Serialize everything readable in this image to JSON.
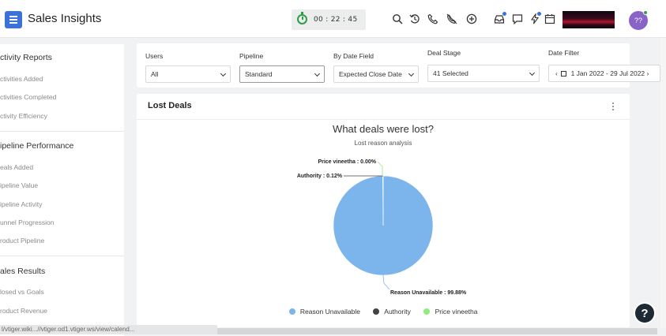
{
  "app": {
    "title": "Sales Insights"
  },
  "header": {
    "timer": "00 : 22 : 45",
    "avatar_text": "??"
  },
  "sidebar": {
    "sections": [
      {
        "title": "ctivity Reports",
        "items": [
          "ctivities Added",
          "ctivities Completed",
          "ctivity Efficiency"
        ]
      },
      {
        "title": "ipeline Performance",
        "items": [
          "eals Added",
          "ipeline Value",
          "ipeline Activity",
          "unnel Progression",
          "roduct Pipeline"
        ]
      },
      {
        "title": "ales Results",
        "items": [
          "losed vs Goals",
          "roduct Revenue"
        ]
      }
    ]
  },
  "filters": {
    "users": {
      "label": "Users",
      "value": "All"
    },
    "pipeline": {
      "label": "Pipeline",
      "value": "Standard"
    },
    "date_field": {
      "label": "By Date Field",
      "value": "Expected Close Date"
    },
    "deal_stage": {
      "label": "Deal Stage",
      "value": "41 Selected"
    },
    "date_filter": {
      "label": "Date Filter",
      "value": "1 Jan 2022 - 29 Jul 2022"
    }
  },
  "card": {
    "title": "Lost Deals"
  },
  "chart_data": {
    "type": "pie",
    "title": "What deals were lost?",
    "subtitle": "Lost reason analysis",
    "legend_position": "bottom",
    "slices": [
      {
        "name": "Reason Unavailable",
        "value": 99.88,
        "label": "Reason Unavailable : 99.88%",
        "color": "#7cb4ec"
      },
      {
        "name": "Authority",
        "value": 0.12,
        "label": "Authority : 0.12%",
        "color": "#434348"
      },
      {
        "name": "Price vineetha",
        "value": 0.0,
        "label": "Price vineetha : 0.00%",
        "color": "#90ed7d"
      }
    ]
  },
  "status_bar": {
    "url": "l/vtiger.wiki...//vtiger.od1.vtiger.ws/view/calend..."
  },
  "colors": {
    "accent": "#3b72d9",
    "surface": "#ffffff",
    "background": "#f1f2f4"
  }
}
